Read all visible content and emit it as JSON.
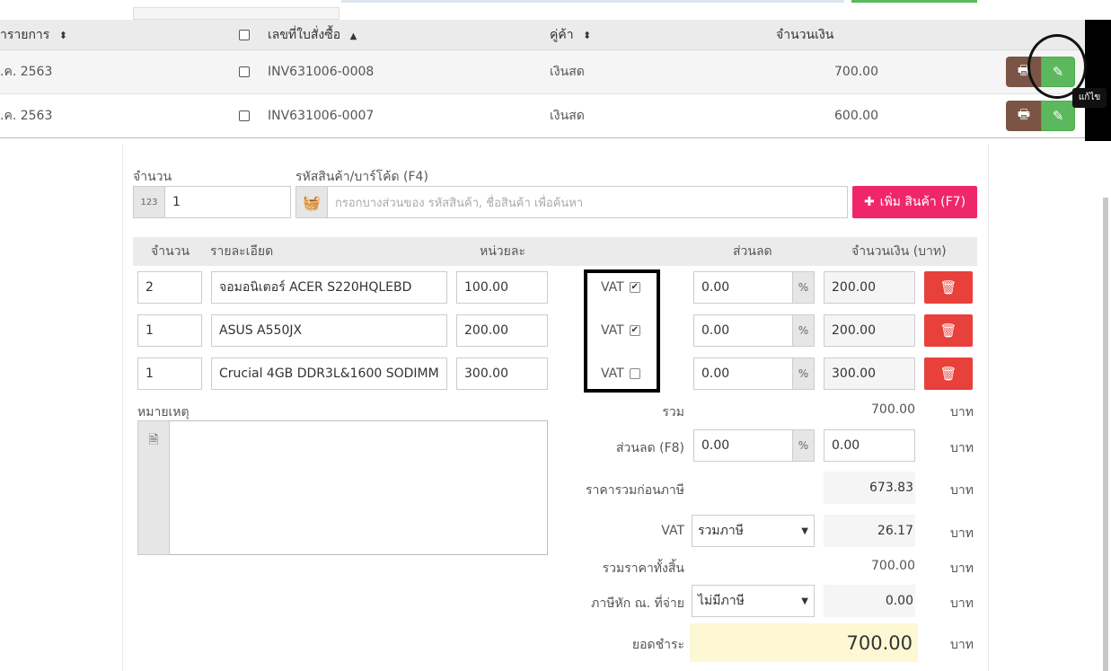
{
  "list": {
    "columns": {
      "date": "ำรายการ",
      "date_sort": "⬍",
      "doc_no": "เลขที่ใบสั่งซื้อ",
      "doc_no_sort": "▲",
      "customer": "คู่ค้า",
      "customer_sort": "⬍",
      "amount": "จำนวนเงิน"
    },
    "rows": [
      {
        "date": ".ค. 2563",
        "doc_no": "INV631006-0008",
        "customer": "เงินสด",
        "amount": "700.00"
      },
      {
        "date": ".ค. 2563",
        "doc_no": "INV631006-0007",
        "customer": "เงินสด",
        "amount": "600.00"
      }
    ],
    "tooltip": "แก้ไข",
    "print_icon": "print-icon",
    "edit_icon": "pencil-icon"
  },
  "entry": {
    "qty_label": "จำนวน",
    "qty_addon": "123",
    "qty_value": "1",
    "code_label": "รหัสสินค้า/บาร์โค้ด (F4)",
    "search_placeholder": "กรอกบางส่วนของ รหัสสินค้า, ชื่อสินค้า เพื่อค้นหา",
    "add_button": "เพิ่ม สินค้า (F7)",
    "accent": "#f0266a"
  },
  "items": {
    "headers": {
      "qty": "จำนวน",
      "detail": "รายละเอียด",
      "unit_price": "หน่วยละ",
      "discount": "ส่วนลด",
      "amount": "จำนวนเงิน (บาท)"
    },
    "rows": [
      {
        "qty": "2",
        "detail": "จอมอนิเตอร์ ACER S220HQLEBD",
        "unit_price": "100.00",
        "vat_label": "VAT",
        "vat_checked": true,
        "discount": "0.00",
        "pct": "%",
        "amount": "200.00"
      },
      {
        "qty": "1",
        "detail": "ASUS A550JX",
        "unit_price": "200.00",
        "vat_label": "VAT",
        "vat_checked": true,
        "discount": "0.00",
        "pct": "%",
        "amount": "200.00"
      },
      {
        "qty": "1",
        "detail": "Crucial 4GB DDR3L&1600 SODIMM",
        "unit_price": "300.00",
        "vat_label": "VAT",
        "vat_checked": false,
        "discount": "0.00",
        "pct": "%",
        "amount": "300.00"
      }
    ]
  },
  "note_label": "หมายเหตุ",
  "summary": {
    "total_label": "รวม",
    "total": "700.00",
    "discount_label": "ส่วนลด (F8)",
    "discount_value": "0.00",
    "discount_pct": "%",
    "discount_amount": "0.00",
    "pretax_label": "ราคารวมก่อนภาษี",
    "pretax": "673.83",
    "vat_label": "VAT",
    "vat_option": "รวมภาษี",
    "vat": "26.17",
    "grand_label": "รวมราคาทั้งสิ้น",
    "grand": "700.00",
    "wht_label": "ภาษีหัก ณ. ที่จ่าย",
    "wht_option": "ไม่มีภาษี",
    "wht": "0.00",
    "pay_label": "ยอดชำระ",
    "pay": "700.00",
    "unit": "บาท"
  }
}
